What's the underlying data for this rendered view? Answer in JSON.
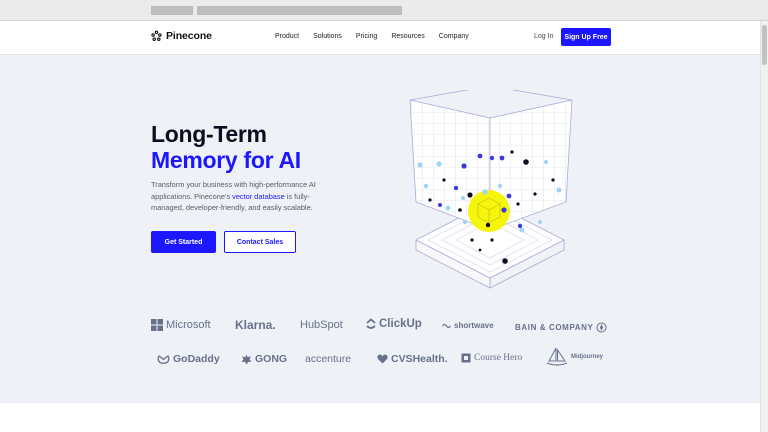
{
  "nav": {
    "logo_text": "Pinecone",
    "menu": [
      "Product",
      "Solutions",
      "Pricing",
      "Resources",
      "Company"
    ],
    "login": "Log In",
    "signup": "Sign Up Free"
  },
  "hero": {
    "title_line1": "Long-Term",
    "title_line2": "Memory for AI",
    "subtitle_pre": "Transform your business with high-performance AI applications. Pinecone's ",
    "subtitle_link": "vector database",
    "subtitle_post": " is fully-managed, developer-friendly, and easily scalable.",
    "cta_primary": "Get Started",
    "cta_secondary": "Contact Sales"
  },
  "brands": {
    "row1": [
      "Microsoft",
      "Klarna.",
      "HubSpot",
      "ClickUp",
      "shortwave",
      "BAIN & COMPANY"
    ],
    "row2": [
      "GoDaddy",
      "GONG",
      "accenture",
      "CVSHealth.",
      "Course Hero",
      "Midjourney"
    ]
  },
  "colors": {
    "accent": "#1c17ff",
    "hero_bg": "#eef1f6",
    "brand_gray": "#68718a",
    "highlight": "#f5f500"
  }
}
